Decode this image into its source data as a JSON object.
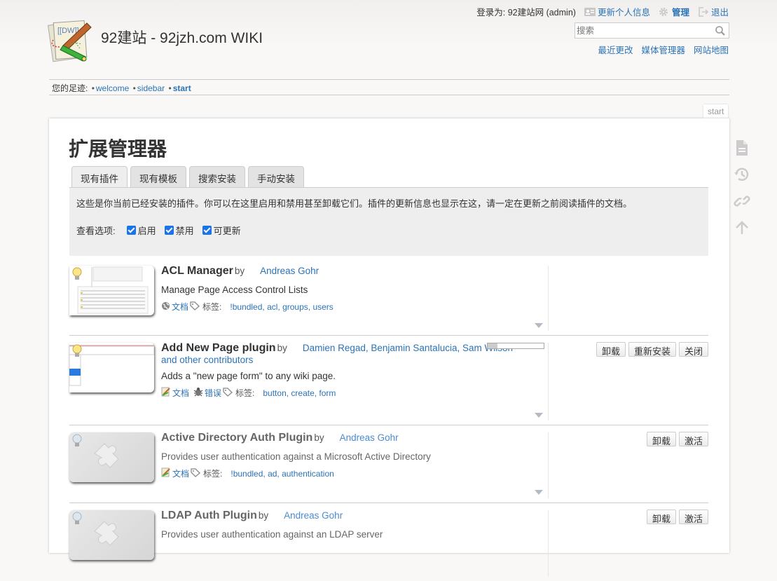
{
  "site": {
    "title": "92建站 - 92jzh.com WIKI",
    "logo_icon": "dokuwiki-logo"
  },
  "userbar": {
    "logged_in_as": "登录为: 92建站网 (admin)",
    "profile_label": "更新个人信息",
    "admin_label": "管理",
    "logout_label": "退出"
  },
  "search": {
    "placeholder": "搜索",
    "value": ""
  },
  "sitetools": [
    "最近更改",
    "媒体管理器",
    "网站地图"
  ],
  "breadcrumbs": {
    "label": "您的足迹:",
    "items": [
      "welcome",
      "sidebar",
      "start"
    ]
  },
  "page": {
    "id": "start",
    "title": "扩展管理器",
    "tabs": [
      "现有插件",
      "现有模板",
      "搜索安装",
      "手动安装"
    ],
    "active_tab": 0,
    "intro": "这些是你当前已经安装的插件。你可以在这里启用和禁用甚至卸载它们。插件的更新信息也显示在这，请一定在更新之前阅读插件的文档。",
    "filter_label": "查看选项:",
    "filters": [
      {
        "label": "启用",
        "checked": true
      },
      {
        "label": "禁用",
        "checked": true
      },
      {
        "label": "可更新",
        "checked": true
      }
    ]
  },
  "plugins": [
    {
      "name": "ACL Manager",
      "by": "by",
      "authors": "Andreas Gohr",
      "description": "Manage Page Access Control Lists",
      "doc_label": "文档",
      "tags_label": "标签:",
      "tags": "!bundled, acl, groups, users",
      "enabled": true,
      "actions": []
    },
    {
      "name": "Add New Page plugin",
      "by": "by",
      "authors": "Damien Regad, Benjamin Santalucia, Sam Wilson",
      "authors_more": "and other contributors",
      "description": "Adds a \"new page form\" to any wiki page.",
      "doc_label": "文档",
      "bug_label": "错误",
      "tags_label": "标签:",
      "tags": "button, create, form",
      "enabled": true,
      "actions": [
        "卸载",
        "重新安装",
        "关闭"
      ]
    },
    {
      "name": "Active Directory Auth Plugin",
      "by": "by",
      "authors": "Andreas Gohr",
      "description": "Provides user authentication against a Microsoft Active Directory",
      "doc_label": "文档",
      "tags_label": "标签:",
      "tags": "!bundled, ad, authentication",
      "enabled": false,
      "actions": [
        "卸载",
        "激活"
      ]
    },
    {
      "name": "LDAP Auth Plugin",
      "by": "by",
      "authors": "Andreas Gohr",
      "description": "Provides user authentication against an LDAP server",
      "enabled": false,
      "actions": [
        "卸载",
        "激活"
      ]
    }
  ],
  "pagetools": [
    "show-page-icon",
    "revisions-icon",
    "backlinks-icon",
    "back-to-top-icon"
  ]
}
